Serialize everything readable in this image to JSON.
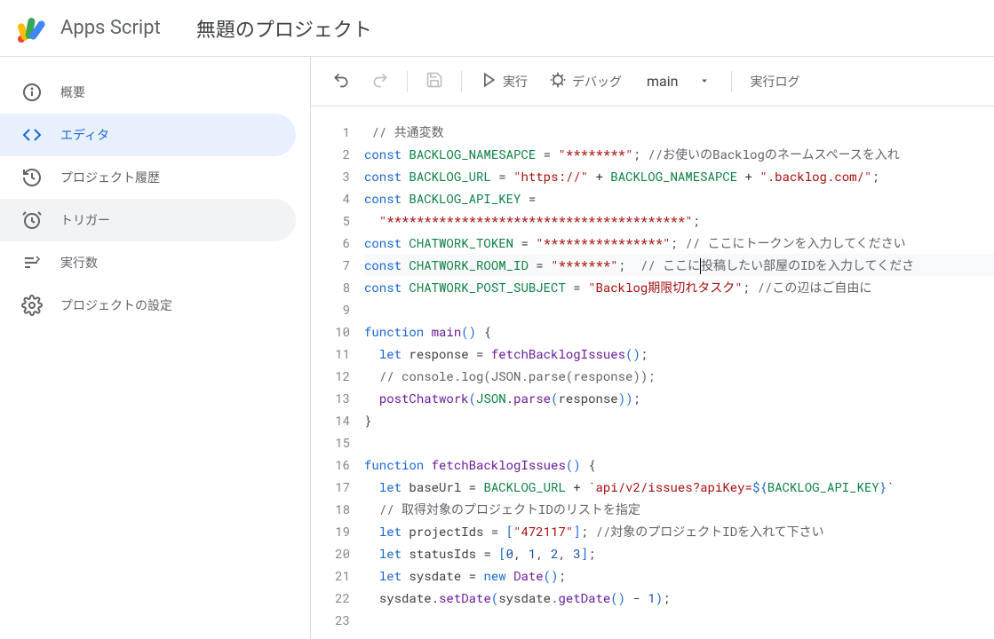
{
  "header": {
    "brand": "Apps Script",
    "project_title": "無題のプロジェクト"
  },
  "sidebar": {
    "items": [
      {
        "label": "概要",
        "icon": "info-icon"
      },
      {
        "label": "エディタ",
        "icon": "code-icon"
      },
      {
        "label": "プロジェクト履歴",
        "icon": "history-icon"
      },
      {
        "label": "トリガー",
        "icon": "alarm-icon"
      },
      {
        "label": "実行数",
        "icon": "list-icon"
      },
      {
        "label": "プロジェクトの設定",
        "icon": "gear-icon"
      }
    ]
  },
  "toolbar": {
    "run_label": "実行",
    "debug_label": "デバッグ",
    "function_selected": "main",
    "log_label": "実行ログ"
  },
  "code": {
    "lines": [
      {
        "n": 1,
        "tokens": [
          [
            " ",
            "pl"
          ],
          [
            "// 共通変数",
            "cmt"
          ]
        ]
      },
      {
        "n": 2,
        "tokens": [
          [
            "const ",
            "kw"
          ],
          [
            "BACKLOG_NAMESAPCE ",
            "const-name"
          ],
          [
            "= ",
            "op"
          ],
          [
            "\"********\"",
            "str"
          ],
          [
            "; ",
            "op"
          ],
          [
            "//お使いのBacklogのネームスペースを入れ",
            "cmt"
          ]
        ]
      },
      {
        "n": 3,
        "tokens": [
          [
            "const ",
            "kw"
          ],
          [
            "BACKLOG_URL ",
            "const-name"
          ],
          [
            "= ",
            "op"
          ],
          [
            "\"https://\"",
            "str"
          ],
          [
            " + ",
            "op"
          ],
          [
            "BACKLOG_NAMESAPCE",
            "const-name"
          ],
          [
            " + ",
            "op"
          ],
          [
            "\".backlog.com/\"",
            "str"
          ],
          [
            ";",
            "op"
          ]
        ]
      },
      {
        "n": 4,
        "tokens": [
          [
            "const ",
            "kw"
          ],
          [
            "BACKLOG_API_KEY ",
            "const-name"
          ],
          [
            "=",
            "op"
          ]
        ]
      },
      {
        "n": 5,
        "tokens": [
          [
            "  ",
            "pl"
          ],
          [
            "\"****************************************\"",
            "str"
          ],
          [
            ";",
            "op"
          ]
        ]
      },
      {
        "n": 6,
        "tokens": [
          [
            "const ",
            "kw"
          ],
          [
            "CHATWORK_TOKEN ",
            "const-name"
          ],
          [
            "= ",
            "op"
          ],
          [
            "\"****************\"",
            "str"
          ],
          [
            "; ",
            "op"
          ],
          [
            "// ここにトークンを入力してください",
            "cmt"
          ]
        ]
      },
      {
        "n": 7,
        "tokens": [
          [
            "const ",
            "kw"
          ],
          [
            "CHATWORK_ROOM_ID ",
            "const-name"
          ],
          [
            "= ",
            "op"
          ],
          [
            "\"*******\"",
            "str"
          ],
          [
            "; ",
            "op"
          ],
          [
            " // ここに",
            "cmt"
          ],
          [
            "|",
            "cursor"
          ],
          [
            "投稿したい部屋のIDを入力してくださ",
            "cmt"
          ]
        ]
      },
      {
        "n": 8,
        "tokens": [
          [
            "const ",
            "kw"
          ],
          [
            "CHATWORK_POST_SUBJECT ",
            "const-name"
          ],
          [
            "= ",
            "op"
          ],
          [
            "\"Backlog期限切れタスク\"",
            "str"
          ],
          [
            "; ",
            "op"
          ],
          [
            "//この辺はご自由に",
            "cmt"
          ]
        ]
      },
      {
        "n": 9,
        "tokens": [
          [
            "",
            "pl"
          ]
        ]
      },
      {
        "n": 10,
        "tokens": [
          [
            "function ",
            "kw"
          ],
          [
            "main",
            "fn"
          ],
          [
            "() ",
            "paren"
          ],
          [
            "{",
            "brace"
          ]
        ]
      },
      {
        "n": 11,
        "tokens": [
          [
            "  ",
            "pl"
          ],
          [
            "let ",
            "kw"
          ],
          [
            "response ",
            "pl"
          ],
          [
            "= ",
            "op"
          ],
          [
            "fetchBacklogIssues",
            "fn"
          ],
          [
            "()",
            "paren"
          ],
          [
            ";",
            "op"
          ]
        ]
      },
      {
        "n": 12,
        "tokens": [
          [
            "  ",
            "pl"
          ],
          [
            "// console.log(JSON.parse(response));",
            "cmt"
          ]
        ]
      },
      {
        "n": 13,
        "tokens": [
          [
            "  ",
            "pl"
          ],
          [
            "postChatwork",
            "fn"
          ],
          [
            "(",
            "paren"
          ],
          [
            "JSON",
            "const-name"
          ],
          [
            ".",
            "op"
          ],
          [
            "parse",
            "fn"
          ],
          [
            "(",
            "paren"
          ],
          [
            "response",
            "pl"
          ],
          [
            "))",
            "paren"
          ],
          [
            ";",
            "op"
          ]
        ]
      },
      {
        "n": 14,
        "tokens": [
          [
            "}",
            "brace"
          ]
        ]
      },
      {
        "n": 15,
        "tokens": [
          [
            "",
            "pl"
          ]
        ]
      },
      {
        "n": 16,
        "tokens": [
          [
            "function ",
            "kw"
          ],
          [
            "fetchBacklogIssues",
            "fn"
          ],
          [
            "() ",
            "paren"
          ],
          [
            "{",
            "brace"
          ]
        ]
      },
      {
        "n": 17,
        "tokens": [
          [
            "  ",
            "pl"
          ],
          [
            "let ",
            "kw"
          ],
          [
            "baseUrl ",
            "pl"
          ],
          [
            "= ",
            "op"
          ],
          [
            "BACKLOG_URL",
            "const-name"
          ],
          [
            " + ",
            "op"
          ],
          [
            "`api/v2/issues?apiKey=",
            "str"
          ],
          [
            "${",
            "paren"
          ],
          [
            "BACKLOG_API_KEY",
            "const-name"
          ],
          [
            "}",
            "paren"
          ],
          [
            "`",
            "str"
          ]
        ]
      },
      {
        "n": 18,
        "tokens": [
          [
            "  ",
            "pl"
          ],
          [
            "// 取得対象のプロジェクトIDのリストを指定",
            "cmt"
          ]
        ]
      },
      {
        "n": 19,
        "tokens": [
          [
            "  ",
            "pl"
          ],
          [
            "let ",
            "kw"
          ],
          [
            "projectIds ",
            "pl"
          ],
          [
            "= ",
            "op"
          ],
          [
            "[",
            "paren"
          ],
          [
            "\"472117\"",
            "str"
          ],
          [
            "]",
            "paren"
          ],
          [
            "; ",
            "op"
          ],
          [
            "//対象のプロジェクトIDを入れて下さい",
            "cmt"
          ]
        ]
      },
      {
        "n": 20,
        "tokens": [
          [
            "  ",
            "pl"
          ],
          [
            "let ",
            "kw"
          ],
          [
            "statusIds ",
            "pl"
          ],
          [
            "= ",
            "op"
          ],
          [
            "[",
            "paren"
          ],
          [
            "0",
            "num"
          ],
          [
            ", ",
            "op"
          ],
          [
            "1",
            "num"
          ],
          [
            ", ",
            "op"
          ],
          [
            "2",
            "num"
          ],
          [
            ", ",
            "op"
          ],
          [
            "3",
            "num"
          ],
          [
            "]",
            "paren"
          ],
          [
            ";",
            "op"
          ]
        ]
      },
      {
        "n": 21,
        "tokens": [
          [
            "  ",
            "pl"
          ],
          [
            "let ",
            "kw"
          ],
          [
            "sysdate ",
            "pl"
          ],
          [
            "= ",
            "op"
          ],
          [
            "new ",
            "kw"
          ],
          [
            "Date",
            "fn"
          ],
          [
            "()",
            "paren"
          ],
          [
            ";",
            "op"
          ]
        ]
      },
      {
        "n": 22,
        "tokens": [
          [
            "  ",
            "pl"
          ],
          [
            "sysdate",
            "pl"
          ],
          [
            ".",
            "op"
          ],
          [
            "setDate",
            "fn"
          ],
          [
            "(",
            "paren"
          ],
          [
            "sysdate",
            "pl"
          ],
          [
            ".",
            "op"
          ],
          [
            "getDate",
            "fn"
          ],
          [
            "()",
            "paren"
          ],
          [
            " - ",
            "op"
          ],
          [
            "1",
            "num"
          ],
          [
            ")",
            "paren"
          ],
          [
            ";",
            "op"
          ]
        ]
      },
      {
        "n": 23,
        "tokens": [
          [
            "",
            "pl"
          ]
        ]
      }
    ]
  }
}
